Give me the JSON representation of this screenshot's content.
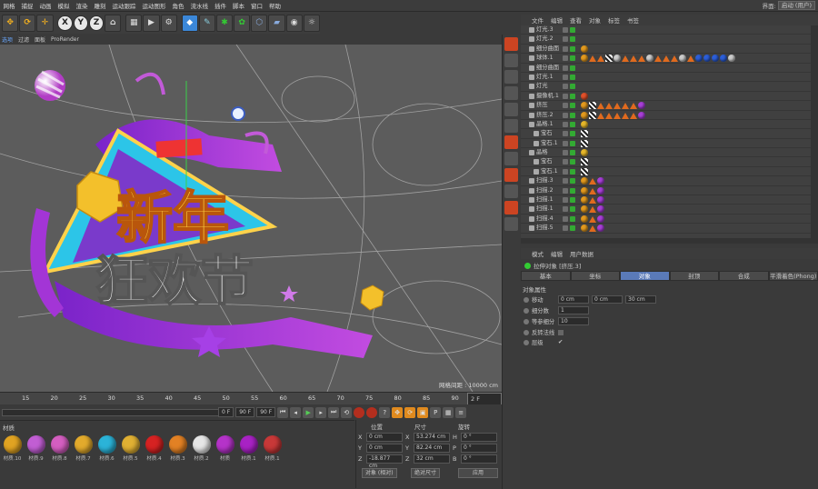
{
  "menubar": {
    "items": [
      "网格",
      "捕捉",
      "动画",
      "模拟",
      "渲染",
      "雕刻",
      "运动跟踪",
      "运动图形",
      "角色",
      "流水线",
      "插件",
      "脚本",
      "窗口",
      "帮助"
    ],
    "layout_label": "界面:",
    "layout_value": "启动 (用户)"
  },
  "toolbar": {
    "axis_x": "X",
    "axis_y": "Y",
    "axis_z": "Z"
  },
  "viewport_menu": {
    "items": [
      "选项",
      "过滤",
      "面板",
      "ProRender"
    ],
    "grid_spacing": "网格间距 : 10000 cm"
  },
  "artwork": {
    "line1": "新年",
    "line2": "狂欢节"
  },
  "timeline": {
    "ticks": [
      "15",
      "20",
      "25",
      "30",
      "35",
      "40",
      "45",
      "50",
      "55",
      "60",
      "65",
      "70",
      "75",
      "80",
      "85",
      "90"
    ],
    "current": "2 F"
  },
  "transport": {
    "start": "0 F",
    "end": "90 F",
    "end2": "90 F"
  },
  "materials": {
    "label": "材质",
    "items": [
      {
        "name": "材质.10",
        "color": "#e0a322"
      },
      {
        "name": "材质.9",
        "color": "#c15ed3"
      },
      {
        "name": "材质.8",
        "color": "#d45ec0"
      },
      {
        "name": "材质.7",
        "color": "#e2aa2c"
      },
      {
        "name": "材质.6",
        "color": "#2bb3d8"
      },
      {
        "name": "材质.5",
        "color": "#e0b033"
      },
      {
        "name": "材质.4",
        "color": "#d62222"
      },
      {
        "name": "材质.3",
        "color": "#e28124"
      },
      {
        "name": "材质.2",
        "color": "#e6e6e6"
      },
      {
        "name": "材质",
        "color": "#b533c9"
      },
      {
        "name": "材质.1",
        "color": "#a822c4"
      },
      {
        "name": "材质.1",
        "color": "#c83838"
      }
    ]
  },
  "coordinates": {
    "h_pos": "位置",
    "h_size": "尺寸",
    "h_rot": "旋转",
    "rows": [
      {
        "axis": "X",
        "pos": "0 cm",
        "saxis": "X",
        "size": "53.274 cm",
        "raxis": "H",
        "rot": "0 °"
      },
      {
        "axis": "Y",
        "pos": "0 cm",
        "saxis": "Y",
        "size": "82.24 cm",
        "raxis": "P",
        "rot": "0 °"
      },
      {
        "axis": "Z",
        "pos": "-18.877 cm",
        "saxis": "Z",
        "size": "32 cm",
        "raxis": "B",
        "rot": "0 °"
      }
    ],
    "mode": "对象 (相对)",
    "size_mode": "绝对尺寸",
    "apply": "应用"
  },
  "object_manager": {
    "menu": [
      "文件",
      "编辑",
      "查看",
      "对象",
      "标签",
      "书签"
    ],
    "objects": [
      {
        "name": "灯光.3",
        "indent": 1,
        "tags": []
      },
      {
        "name": "灯光.2",
        "indent": 1,
        "tags": []
      },
      {
        "name": "细分曲面",
        "indent": 1,
        "tags": [
          "o"
        ]
      },
      {
        "name": "球体.1",
        "indent": 1,
        "tags": [
          "o",
          "t",
          "t",
          "ck",
          "g",
          "t",
          "t",
          "t",
          "g",
          "t",
          "t",
          "t",
          "g",
          "t",
          "b",
          "b",
          "b",
          "b",
          "g"
        ]
      },
      {
        "name": "细分曲面",
        "indent": 1,
        "tags": []
      },
      {
        "name": "灯光.1",
        "indent": 1,
        "tags": []
      },
      {
        "name": "灯光",
        "indent": 1,
        "tags": []
      },
      {
        "name": "摄像机.1",
        "indent": 1,
        "tags": [
          "r"
        ]
      },
      {
        "name": "挤压",
        "indent": 1,
        "tags": [
          "o",
          "ck",
          "t",
          "t",
          "t",
          "t",
          "t",
          "p"
        ]
      },
      {
        "name": "挤压.2",
        "indent": 1,
        "tags": [
          "o",
          "ck",
          "t",
          "t",
          "t",
          "t",
          "t",
          "p"
        ]
      },
      {
        "name": "晶格.1",
        "indent": 1,
        "tags": [
          "y"
        ]
      },
      {
        "name": "宝石",
        "indent": 2,
        "tags": [
          "ck"
        ]
      },
      {
        "name": "宝石.1",
        "indent": 2,
        "tags": [
          "ck"
        ]
      },
      {
        "name": "晶格",
        "indent": 1,
        "tags": [
          "y"
        ]
      },
      {
        "name": "宝石",
        "indent": 2,
        "tags": [
          "ck"
        ]
      },
      {
        "name": "宝石.1",
        "indent": 2,
        "tags": [
          "ck"
        ]
      },
      {
        "name": "扫描.3",
        "indent": 1,
        "tags": [
          "o",
          "t",
          "p"
        ]
      },
      {
        "name": "扫描.2",
        "indent": 1,
        "tags": [
          "o",
          "t",
          "p"
        ]
      },
      {
        "name": "扫描.1",
        "indent": 1,
        "tags": [
          "o",
          "t",
          "p"
        ]
      },
      {
        "name": "扫描.1",
        "indent": 1,
        "tags": [
          "o",
          "t",
          "p"
        ]
      },
      {
        "name": "扫描.4",
        "indent": 1,
        "tags": [
          "o",
          "t",
          "p"
        ]
      },
      {
        "name": "扫描.5",
        "indent": 1,
        "tags": [
          "o",
          "t",
          "p"
        ]
      }
    ]
  },
  "attributes": {
    "menu": [
      "模式",
      "编辑",
      "用户数据"
    ],
    "object_title": "拉伸对象 [挤压.3]",
    "tabs": [
      "基本",
      "坐标",
      "对象",
      "封顶",
      "合成",
      "平滑着色(Phong)"
    ],
    "section": "对象属性",
    "move_label": "移动",
    "move": [
      "0 cm",
      "0 cm",
      "30 cm"
    ],
    "subdiv_label": "细分数",
    "subdiv": "1",
    "iso_label": "等参细分",
    "iso": "10",
    "flip_label": "反转法线",
    "layer_label": "层级",
    "layer_check": "✔"
  }
}
